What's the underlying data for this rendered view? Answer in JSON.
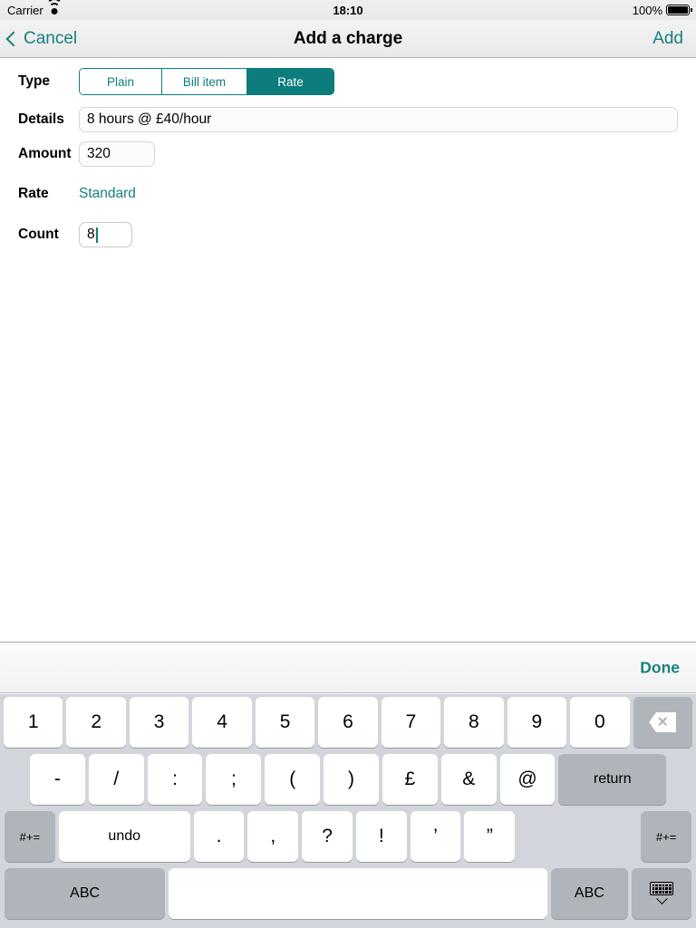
{
  "status_bar": {
    "carrier": "Carrier",
    "wifi_icon": "wifi-icon",
    "time": "18:10",
    "battery_percent": "100%",
    "battery_icon": "battery-full-icon"
  },
  "nav_bar": {
    "back_icon": "chevron-left-icon",
    "cancel_label": "Cancel",
    "title": "Add a charge",
    "add_label": "Add"
  },
  "form": {
    "type": {
      "label": "Type",
      "options": [
        "Plain",
        "Bill item",
        "Rate"
      ],
      "selected": "Rate"
    },
    "details": {
      "label": "Details",
      "value": "8 hours @ £40/hour",
      "placeholder": ""
    },
    "amount": {
      "label": "Amount",
      "value": "320",
      "placeholder": ""
    },
    "rate": {
      "label": "Rate",
      "value": "Standard"
    },
    "count": {
      "label": "Count",
      "value": "8",
      "placeholder": "",
      "focused": true
    }
  },
  "keyboard": {
    "accessory": {
      "done_label": "Done"
    },
    "row1": [
      "1",
      "2",
      "3",
      "4",
      "5",
      "6",
      "7",
      "8",
      "9",
      "0"
    ],
    "backspace_icon": "backspace-icon",
    "row2": [
      "-",
      "/",
      ":",
      ";",
      "(",
      ")",
      "£",
      "&",
      "@"
    ],
    "return_label": "return",
    "row3_left_label": "#+=",
    "undo_label": "undo",
    "row3": [
      ".",
      ",",
      "?",
      "!",
      "’",
      "”"
    ],
    "row3_right_label": "#+=",
    "abc_left_label": "ABC",
    "space_label": "",
    "abc_right_label": "ABC",
    "dismiss_icon": "keyboard-dismiss-icon"
  },
  "colors": {
    "accent_teal": "#0c7d7c",
    "link_teal": "#17807f",
    "keyboard_bg": "#d2d5db",
    "key_dark": "#b0b4bb"
  }
}
